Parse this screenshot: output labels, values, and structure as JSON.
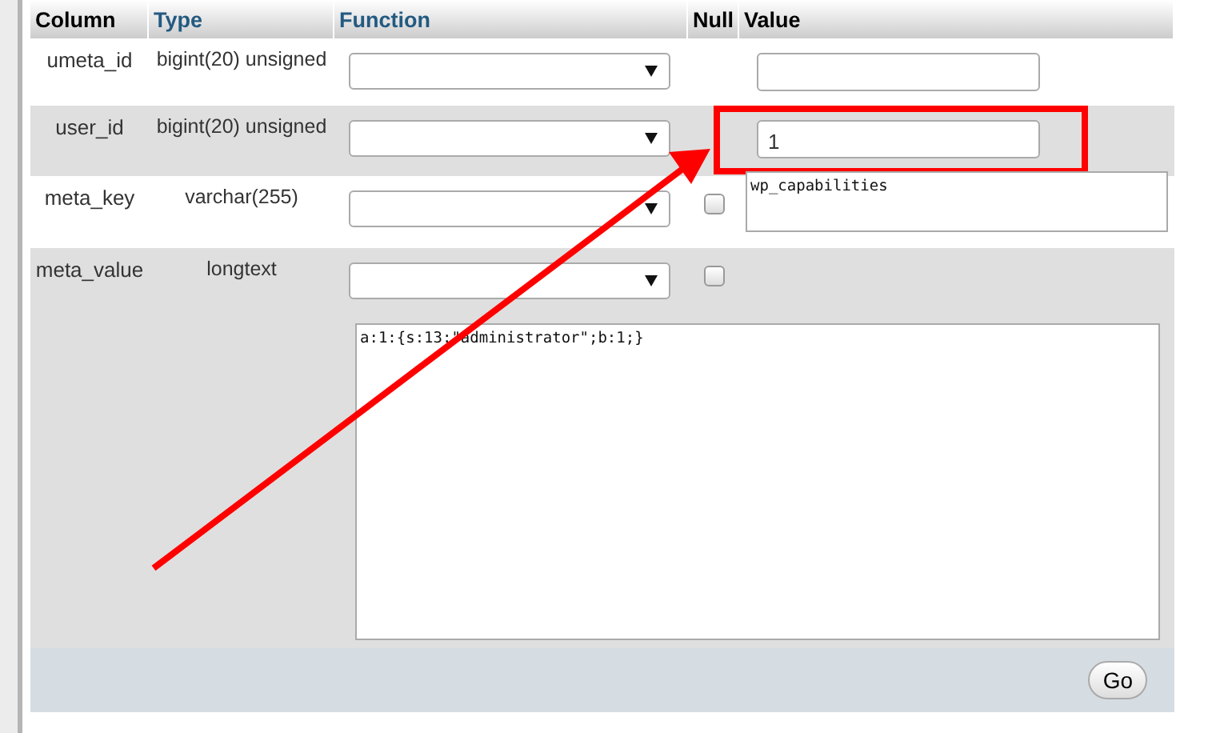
{
  "table": {
    "columns": [
      {
        "label": "Column",
        "kind": "plain"
      },
      {
        "label": "Type",
        "kind": "link"
      },
      {
        "label": "Function",
        "kind": "link"
      },
      {
        "label": "Null",
        "kind": "plain"
      },
      {
        "label": "Value",
        "kind": "plain"
      }
    ],
    "rows": [
      {
        "column": "umeta_id",
        "type": "bigint(20) unsigned",
        "kind": "input",
        "value": "",
        "highlighted": false
      },
      {
        "column": "user_id",
        "type": "bigint(20) unsigned",
        "kind": "input",
        "value": "1",
        "highlighted": true
      },
      {
        "column": "meta_key",
        "type": "varchar(255)",
        "kind": "textarea",
        "value": "wp_capabilities",
        "null_checked": false,
        "highlighted": false
      },
      {
        "column": "meta_value",
        "type": "longtext",
        "kind": "longtext",
        "value": "a:1:{s:13:\"administrator\";b:1;}",
        "null_checked": false,
        "highlighted": false
      }
    ]
  },
  "go_button": "Go"
}
